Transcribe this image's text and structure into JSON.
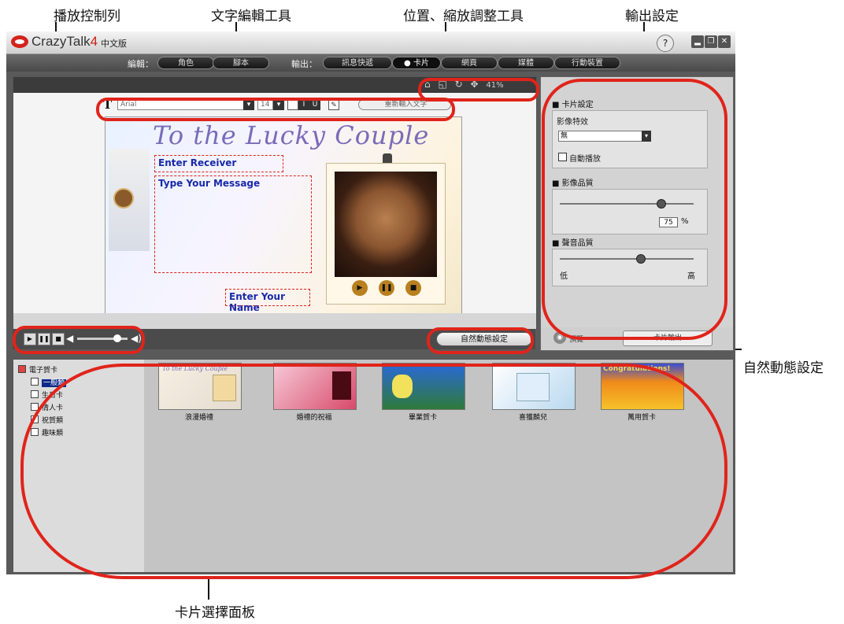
{
  "annotations": {
    "playback_control": "播放控制列",
    "text_tools": "文字編輯工具",
    "position_tools": "位置、縮放調整工具",
    "output_settings": "輸出設定",
    "natural_motion": "自然動態設定",
    "card_panel": "卡片選擇面板"
  },
  "app": {
    "logo_main": "CrazyTalk",
    "logo_version": "4",
    "logo_sub": "中文版",
    "help": "?"
  },
  "menu": {
    "edit_label": "編輯：",
    "edit_items": [
      "角色",
      "腳本"
    ],
    "output_label": "輸出：",
    "output_items": [
      "訊息快遞",
      "卡片",
      "網頁",
      "媒體",
      "行動裝置"
    ],
    "active": "卡片"
  },
  "stage": {
    "zoom": "41%",
    "font_name": "Arial",
    "font_size": "14",
    "bold": "B",
    "italic": "I",
    "underline": "U",
    "text_button": "重新輸入文字"
  },
  "card": {
    "title": "To the Lucky Couple",
    "receiver": "Enter Receiver",
    "message": "Type Your Message",
    "name": "Enter Your Name"
  },
  "playback": {
    "natural_motion_button": "自然動態設定"
  },
  "settings": {
    "card_settings": "卡片設定",
    "image_effect": "影像特效",
    "effect_value": "無",
    "autoplay": "自動播放",
    "image_quality": "影像品質",
    "quality_value": "75",
    "percent": "%",
    "audio_quality": "聲音品質",
    "low": "低",
    "high": "高",
    "audio_level": 0.6,
    "image_level": 0.75,
    "bottom_left": "預覽",
    "bottom_right": "卡片輸出"
  },
  "card_panel": {
    "tree_root": "電子賀卡",
    "tree_items": [
      "一般類",
      "生日卡",
      "情人卡",
      "祝賀類",
      "趣味類"
    ],
    "selected": "一般類",
    "thumbs": [
      {
        "caption": "浪漫婚禮",
        "color": "#f1e9dc"
      },
      {
        "caption": "婚禮的祝福",
        "color": "#d84a6a"
      },
      {
        "caption": "畢業賀卡",
        "color": "#2f7a3a"
      },
      {
        "caption": "喜獲麟兒",
        "color": "#b9d8ef"
      },
      {
        "caption": "萬用賀卡",
        "color": "#f08a1a"
      }
    ],
    "thumb_text_1": "To the Lucky Couple",
    "thumb_text_5": "Congratulations!"
  },
  "colors": {
    "annotation_ring": "#e0241b",
    "brand_red": "#c81e16"
  }
}
